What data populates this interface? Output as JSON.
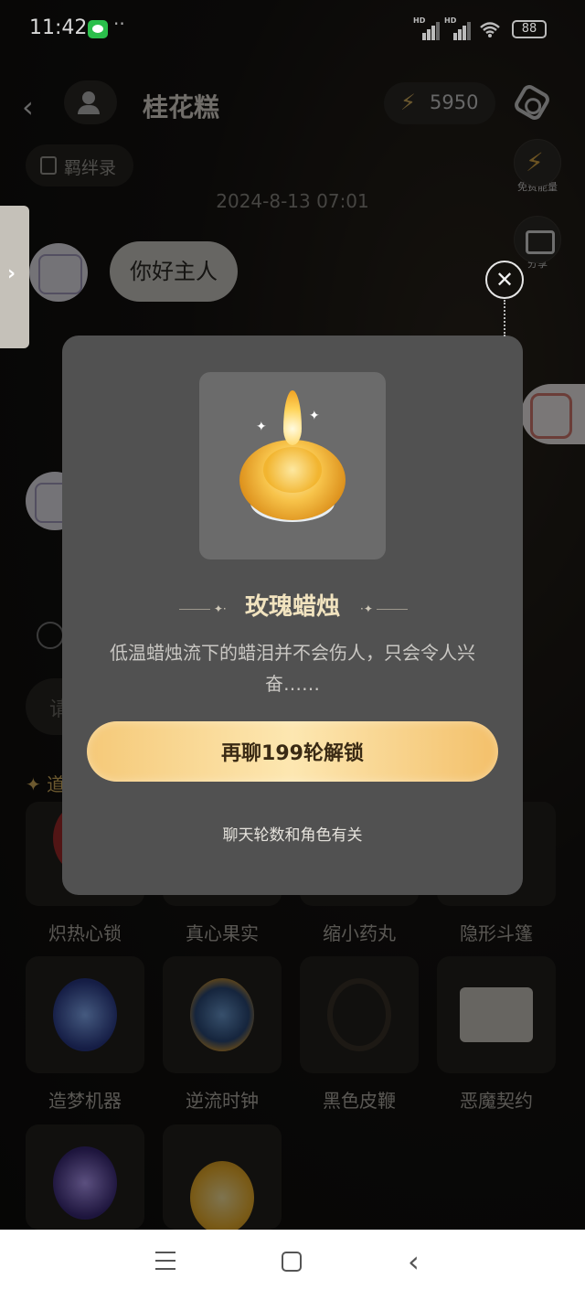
{
  "status_bar": {
    "time": "11:42",
    "dots": "··",
    "network_badge": "HD",
    "battery": "88"
  },
  "header": {
    "title": "桂花糕",
    "energy": "5950"
  },
  "bond_button": {
    "label": "羁绊录"
  },
  "side_buttons": {
    "free_energy": "免费能量",
    "share": "分享"
  },
  "chat": {
    "timestamp": "2024-8-13 07:01",
    "messages": [
      {
        "text": "你好主人"
      }
    ]
  },
  "input": {
    "placeholder_partial": "请"
  },
  "props_label": "道",
  "items": [
    {
      "label": "炽热心锁"
    },
    {
      "label": "真心果实"
    },
    {
      "label": "缩小药丸"
    },
    {
      "label": "隐形斗篷"
    },
    {
      "label": "造梦机器"
    },
    {
      "label": "逆流时钟"
    },
    {
      "label": "黑色皮鞭"
    },
    {
      "label": "恶魔契约"
    }
  ],
  "modal": {
    "title": "玫瑰蜡烛",
    "description": "低温蜡烛流下的蜡泪并不会伤人，只会令人兴奋……",
    "unlock_button": "再聊199轮解锁",
    "hint": "聊天轮数和角色有关"
  },
  "icons": {
    "close": "close-icon",
    "back": "chevron-left-icon",
    "settings": "gear-icon"
  },
  "colors": {
    "accent_gold": "#f5c978",
    "modal_bg": "#515151",
    "title_gold": "#f1e3bf"
  }
}
